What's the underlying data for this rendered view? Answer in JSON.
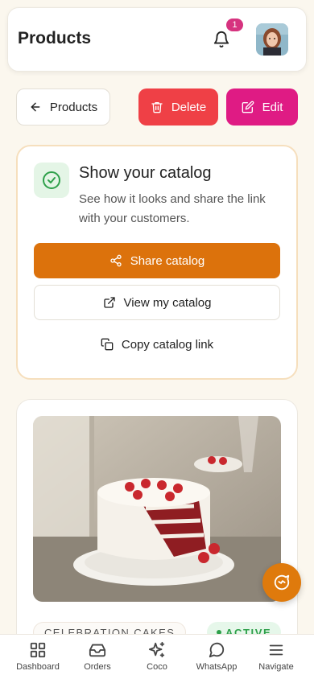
{
  "header": {
    "title": "Products",
    "notification_count": "1",
    "bell_icon": "bell-icon",
    "avatar": "user-avatar"
  },
  "actions": {
    "back_label": "Products",
    "delete_label": "Delete",
    "edit_label": "Edit"
  },
  "catalog": {
    "title": "Show your catalog",
    "description": "See how it looks and share the link with your customers.",
    "share_label": "Share catalog",
    "view_label": "View my catalog",
    "copy_label": "Copy catalog link"
  },
  "product": {
    "category": "CELEBRATION CAKES",
    "status": "ACTIVE"
  },
  "nav": {
    "items": [
      {
        "label": "Dashboard",
        "icon": "grid-icon"
      },
      {
        "label": "Orders",
        "icon": "inbox-icon"
      },
      {
        "label": "Coco",
        "icon": "sparkle-icon"
      },
      {
        "label": "WhatsApp",
        "icon": "chat-icon"
      },
      {
        "label": "Navigate",
        "icon": "menu-icon"
      }
    ]
  },
  "colors": {
    "brand_orange": "#dc720c",
    "delete_red": "#ef4046",
    "edit_pink": "#df1b84",
    "active_green": "#2ea04a",
    "background": "#fbf7ee"
  }
}
